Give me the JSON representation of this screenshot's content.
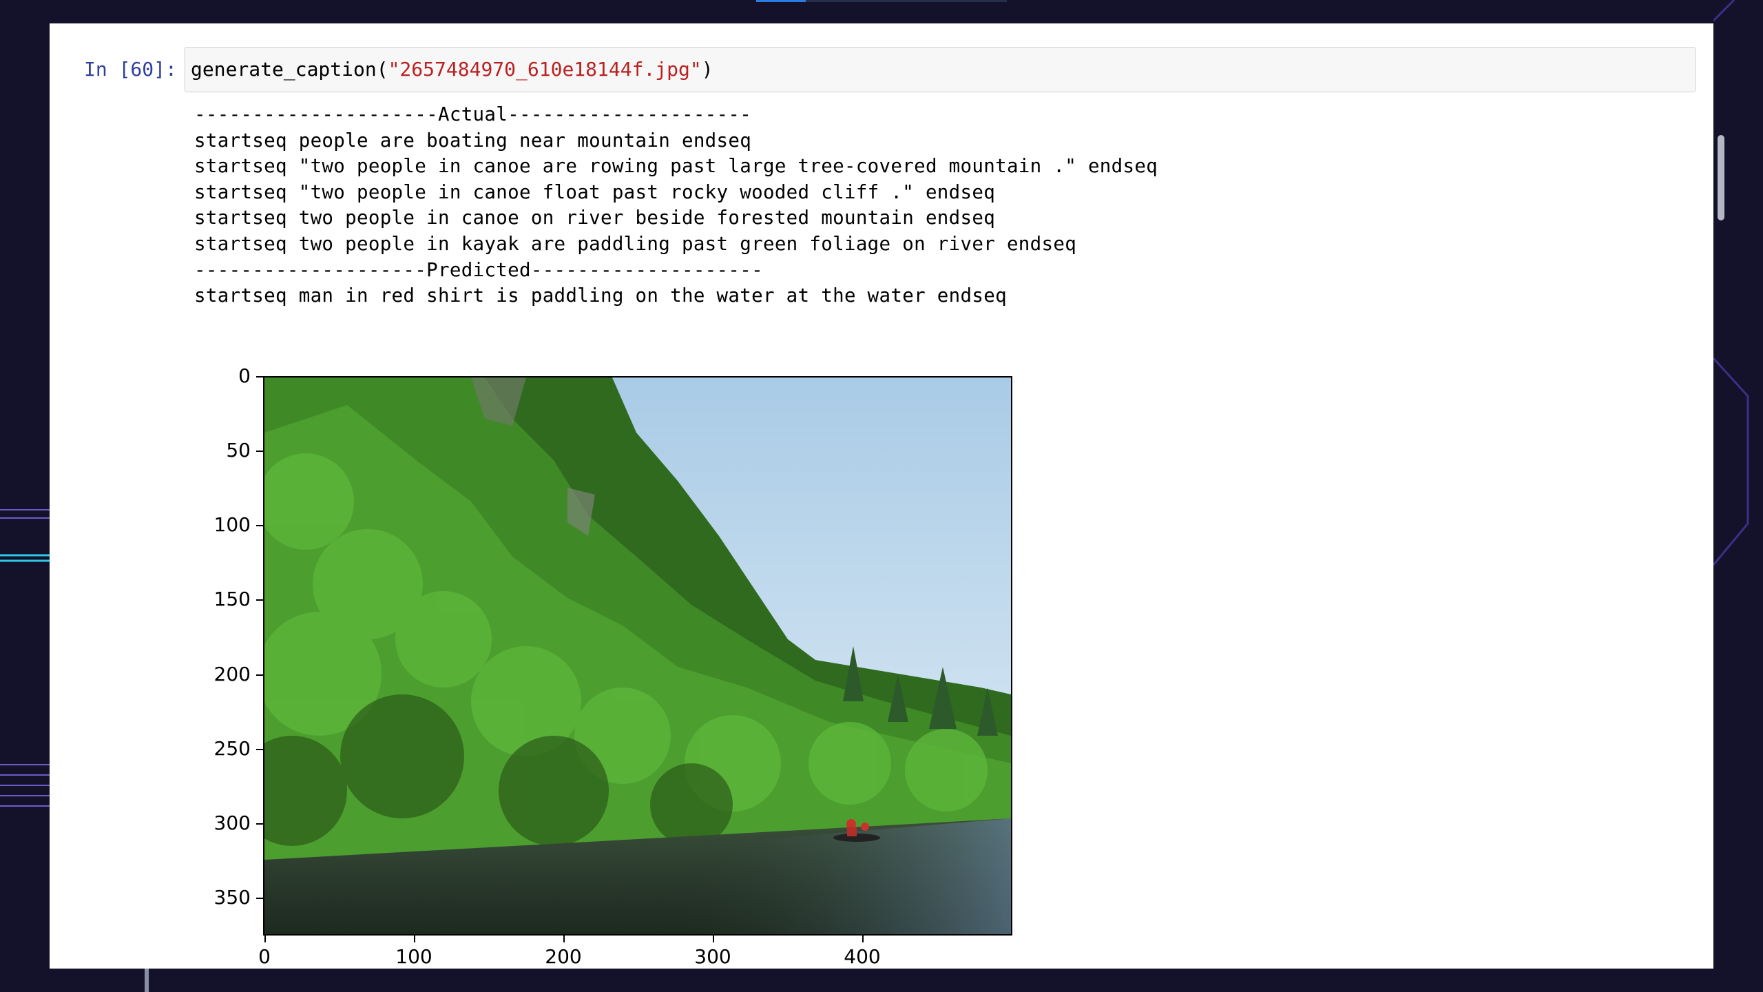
{
  "cell": {
    "prompt": "In [60]:",
    "code_func": "generate_caption(",
    "code_arg": "\"2657484970_610e18144f.jpg\"",
    "code_close": ")"
  },
  "output": {
    "lines": [
      "---------------------Actual---------------------",
      "startseq people are boating near mountain endseq",
      "startseq \"two people in canoe are rowing past large tree-covered mountain .\" endseq",
      "startseq \"two people in canoe float past rocky wooded cliff .\" endseq",
      "startseq two people in canoe on river beside forested mountain endseq",
      "startseq two people in kayak are paddling past green foliage on river endseq",
      "--------------------Predicted--------------------",
      "startseq man in red shirt is paddling on the water at the water endseq"
    ]
  },
  "image_plot": {
    "y_ticks": [
      "0",
      "50",
      "100",
      "150",
      "200",
      "250",
      "300",
      "350"
    ],
    "x_ticks": [
      "0",
      "100",
      "200",
      "300",
      "400"
    ],
    "image_description_icon": "river-canoe-photo"
  },
  "colors": {
    "background": "#13122a",
    "prompt": "#303f9f",
    "string": "#ba2121"
  }
}
